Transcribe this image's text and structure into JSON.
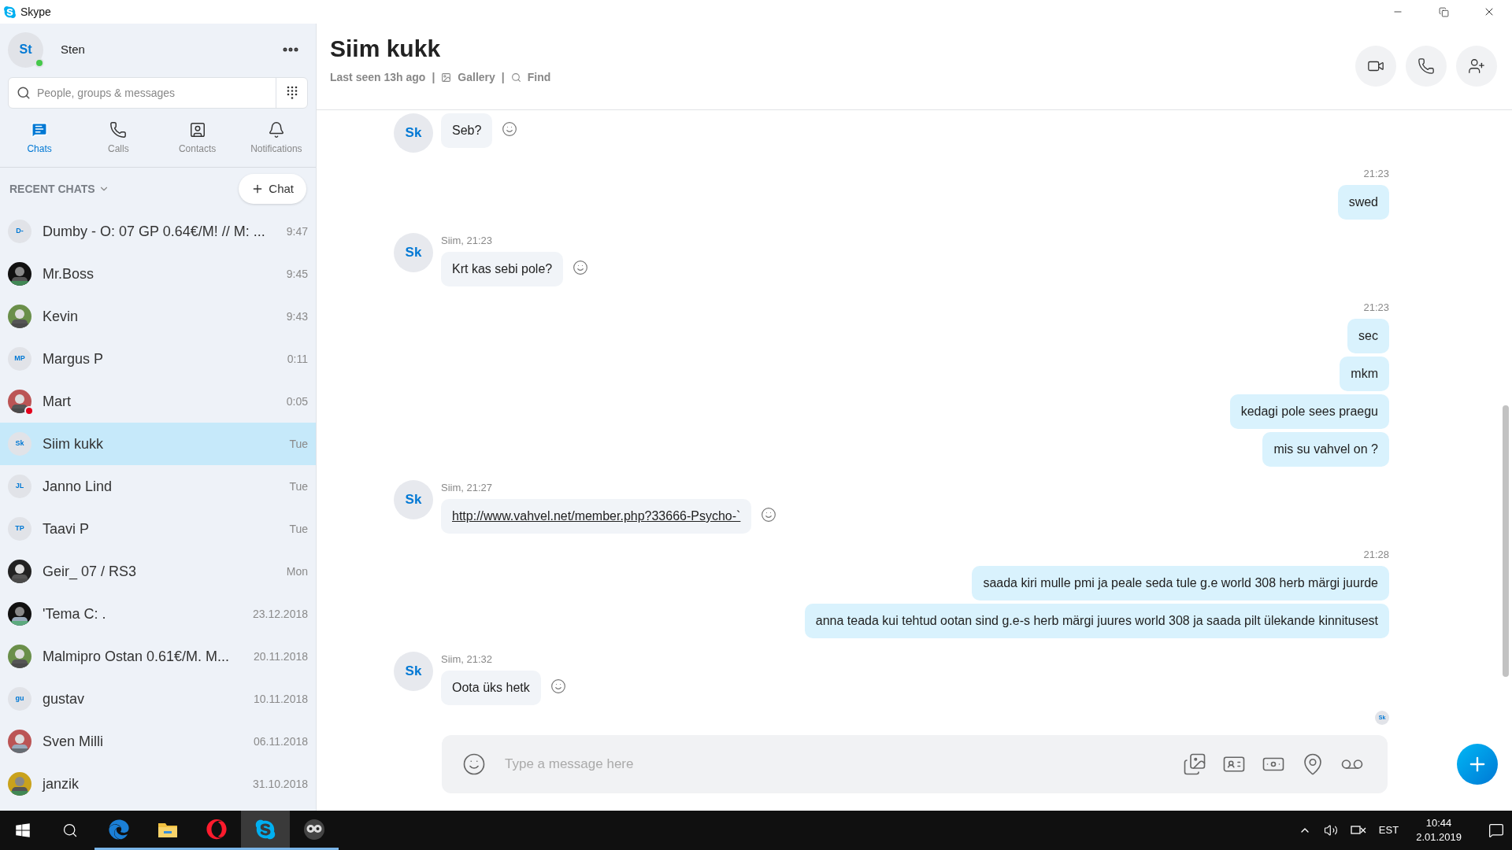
{
  "window": {
    "title": "Skype"
  },
  "profile": {
    "initials": "St",
    "name": "Sten",
    "status": {
      "color": "#45c84a"
    }
  },
  "search": {
    "placeholder": "People, groups & messages"
  },
  "tabs": [
    {
      "label": "Chats",
      "selected": true
    },
    {
      "label": "Calls",
      "selected": false
    },
    {
      "label": "Contacts",
      "selected": false
    },
    {
      "label": "Notifications",
      "selected": false
    }
  ],
  "recent_header": "RECENT CHATS",
  "new_chat_button": "Chat",
  "chats": [
    {
      "avatar": {
        "kind": "initials",
        "text": "D-"
      },
      "name": "Dumby - O: 07 GP 0.64€/M! // M: ...",
      "time": "9:47",
      "selected": false
    },
    {
      "name": "Mr.Boss",
      "time": "9:45",
      "selected": false
    },
    {
      "name": "Kevin",
      "time": "9:43",
      "selected": false
    },
    {
      "avatar": {
        "kind": "initials",
        "text": "MP"
      },
      "name": "Margus P",
      "time": "0:11",
      "selected": false
    },
    {
      "name": "Mart",
      "time": "0:05",
      "status": {
        "color": "#e3001b"
      },
      "selected": false
    },
    {
      "avatar": {
        "kind": "initials",
        "text": "Sk"
      },
      "name": "Siim kukk",
      "time": "Tue",
      "selected": true
    },
    {
      "avatar": {
        "kind": "initials",
        "text": "JL"
      },
      "name": "Janno Lind",
      "time": "Tue",
      "selected": false
    },
    {
      "avatar": {
        "kind": "initials",
        "text": "TP"
      },
      "name": "Taavi P",
      "time": "Tue",
      "selected": false
    },
    {
      "name": "Geir_ 07 / RS3",
      "time": "Mon",
      "selected": false
    },
    {
      "name": "'Tema C: .",
      "time": "23.12.2018",
      "selected": false
    },
    {
      "name": "Malmipro Ostan 0.61€/M. M...",
      "time": "20.11.2018",
      "selected": false
    },
    {
      "avatar": {
        "kind": "initials",
        "text": "gu"
      },
      "name": "gustav",
      "time": "10.11.2018",
      "selected": false
    },
    {
      "name": "Sven Milli",
      "time": "06.11.2018",
      "selected": false
    },
    {
      "name": "janzik",
      "time": "31.10.2018",
      "selected": false
    }
  ],
  "conversation": {
    "title": "Siim kukk",
    "last_seen": "Last seen 13h ago",
    "separators": [
      "|",
      "|"
    ],
    "gallery": "Gallery",
    "find": "Find"
  },
  "messages": [
    {
      "kind": "incoming",
      "avatar": "Sk",
      "items": [
        {
          "kind": "text",
          "text": "Seb?"
        }
      ]
    },
    {
      "kind": "outgoing",
      "meta": "21:23",
      "items": [
        {
          "kind": "text",
          "text": "swed"
        }
      ]
    },
    {
      "kind": "incoming",
      "avatar": "Sk",
      "meta": "Siim, 21:23",
      "items": [
        {
          "kind": "text",
          "text": "Krt kas sebi pole?"
        }
      ]
    },
    {
      "kind": "outgoing",
      "meta": "21:23",
      "items": [
        {
          "kind": "text",
          "text": "sec"
        },
        {
          "kind": "text",
          "text": "mkm"
        },
        {
          "kind": "text",
          "text": "kedagi pole sees praegu"
        },
        {
          "kind": "text",
          "text": "mis su vahvel on ?"
        }
      ]
    },
    {
      "kind": "incoming",
      "avatar": "Sk",
      "meta": "Siim, 21:27",
      "items": [
        {
          "kind": "link",
          "text": "http://www.vahvel.net/member.php?33666-Psycho-`"
        }
      ]
    },
    {
      "kind": "outgoing",
      "meta": "21:28",
      "items": [
        {
          "kind": "text",
          "text": "saada kiri mulle pmi  ja peale seda tule g.e world 308 herb märgi juurde"
        },
        {
          "kind": "text",
          "text": "anna teada kui tehtud ootan sind g.e-s herb märgi juures world 308 ja saada pilt ülekande kinnitusest"
        }
      ]
    },
    {
      "kind": "incoming",
      "avatar": "Sk",
      "meta": "Siim, 21:32",
      "items": [
        {
          "kind": "text",
          "text": "Oota üks hetk"
        }
      ]
    }
  ],
  "read_receipt": "Sk",
  "composer": {
    "placeholder": "Type a message here"
  },
  "taskbar": {
    "apps": [
      {
        "kind": "edge",
        "selected": false
      },
      {
        "kind": "folder",
        "selected": false
      },
      {
        "kind": "opera",
        "selected": false
      },
      {
        "kind": "skype",
        "selected": true
      },
      {
        "kind": "owl",
        "selected": false
      }
    ],
    "language": "EST",
    "time": "10:44",
    "date": "2.01.2019"
  }
}
